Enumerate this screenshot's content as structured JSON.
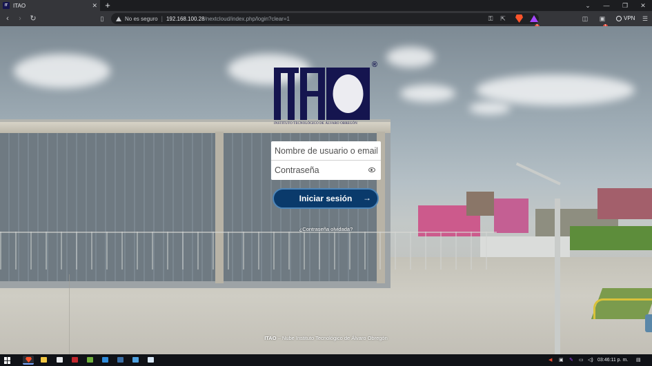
{
  "browser": {
    "tab": {
      "title": "ITAO",
      "favicon_text": "IT"
    },
    "new_tab_label": "+",
    "close_tab_label": "✕",
    "window_controls": {
      "dropdown": "⌄",
      "minimize": "—",
      "restore": "❐",
      "close": "✕"
    },
    "toolbar": {
      "back": "‹",
      "forward": "›",
      "reload": "↻"
    },
    "address": {
      "security_label": "No es seguro",
      "host": "192.168.100.28",
      "path": "/nextcloud/index.php/login?clear=1"
    },
    "badges": {
      "rewards": "1",
      "extensions": "1"
    },
    "vpn_label": "VPN"
  },
  "login": {
    "logo_mark": "®",
    "logo_subtitle": "INSTITUTO TECNOLÓGICO DE ÁLVARO OBREGÓN",
    "username_placeholder": "Nombre de usuario o email",
    "password_placeholder": "Contraseña",
    "submit_label": "Iniciar sesión",
    "submit_arrow": "→",
    "forgot_password": "¿Contraseña olvidada?",
    "footer_brand": "ITAO",
    "footer_text": " – Nube Instituto Tecnológico de Álvaro Obregón"
  },
  "taskbar": {
    "clock": "03:46:11 p. m.",
    "apps": [
      "brave",
      "file-explorer",
      "store",
      "filezilla",
      "winscp",
      "vscode",
      "terminal",
      "photos",
      "snip"
    ]
  },
  "colors": {
    "brand_navy": "#15154f",
    "button_bg": "#0a3a6b",
    "button_border": "#4f86b8"
  }
}
